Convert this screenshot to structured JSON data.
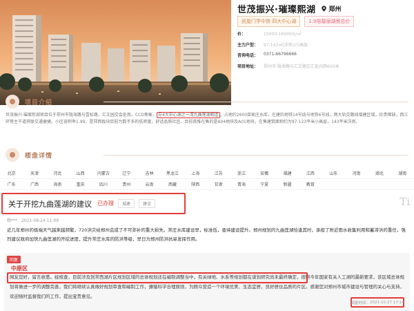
{
  "project": {
    "title": "世茂振兴·璀璨熙湖",
    "city": "郑州",
    "tags": [
      "凯旋门学中铁 四大中心湖",
      "1.9倍靓丽湖景总价"
    ],
    "fields": [
      {
        "key": "价：",
        "value": "15000-16500元/㎡"
      },
      {
        "key": "主力户型：",
        "value": "97-143㎡(洋房)/小高层"
      },
      {
        "key": "咨询电话：",
        "value": "0371-66796666"
      },
      {
        "key": "项目地址：",
        "value": "郑州市·陇海路与汇文路交汇处向西600米"
      }
    ]
  },
  "intro_section": {
    "title": "项目介绍"
  },
  "intro": {
    "part1": "世茂振兴·璀璨熙湖项目位于郑州市陇海路与雪松路，汇文园交会处南。CCD焦衡，",
    "highlight": "与4大中心湖之一湾九曲莲湖相连",
    "part2": "，占地约2600亩家庄水库。在建的地铁14号线与地铁6号线，两大轨交路线增建区域，珍贵稀缺，西三环等主干道将联交通便捷。小区容积率1.99，是郑西板块目前为数不多的低密度，舒适品质社区。目前首推在售的是A04地块及A01地块，在售建筑面积约为97-123平米小高层，143平米洋房。"
  },
  "detail_section": {
    "title": "楼盘详情"
  },
  "provinces": [
    [
      "北京",
      "天津",
      "河北",
      "山西",
      "内蒙古",
      "辽宁",
      "吉林",
      "黑龙江",
      "上海",
      "江苏",
      "浙江",
      "安徽",
      "福建",
      "江西",
      "山东",
      "河南",
      "湖北",
      "湖南"
    ],
    [
      "广东",
      "广西",
      "海南",
      "重庆",
      "四川",
      "贵州",
      "云南",
      "西藏",
      "陕西",
      "甘肃",
      "青海",
      "宁夏",
      "新疆",
      "教育"
    ]
  ],
  "article": {
    "title": "关于开挖九曲莲湖的建议",
    "status": "已办理",
    "buttons": [
      "城建",
      "建议"
    ],
    "watermark": "Ti",
    "author": "杨***",
    "date": "2021-08-24 11:09",
    "body": "近几年郑州的极端天气越来越频繁，720洪灾给郑州造成了不可弥补的重大损失。常庄水库建设早，标准低，亟待建设提升。郑州规划的九曲莲湖恰逢其时，承担了附近雨水收集利用和蓄滞洪的重任，强烈建议政府加快九曲莲湖的开挖进度，提升常庄水库的防洪等级，早日为郑州防洪抗旱发挥作用。"
  },
  "reply": {
    "tag": "回复",
    "org": "中原区",
    "body": "网友您好，留言收悉。经核查，目前涉及到常西湖片区规划区域的总体规划还在编制调整当中，有关绿地、水系等规划都在谋划研究尚未最终确定，按照今年国家有关人工湖的最新要求，该区域总体规划将做进一步的调整完善，我们将继续认真做好规划审查和编制工作，遵循科学合理原则，为群众营造一个环境优美、生态宜居，良好居住品质的片区。感谢您对郑州市城市建设与管理的关心与支持，欢迎随时监督我们的工作，提出宝贵意见。",
    "time_label": "回复时间：",
    "time": "2021-10-27 17:14"
  }
}
